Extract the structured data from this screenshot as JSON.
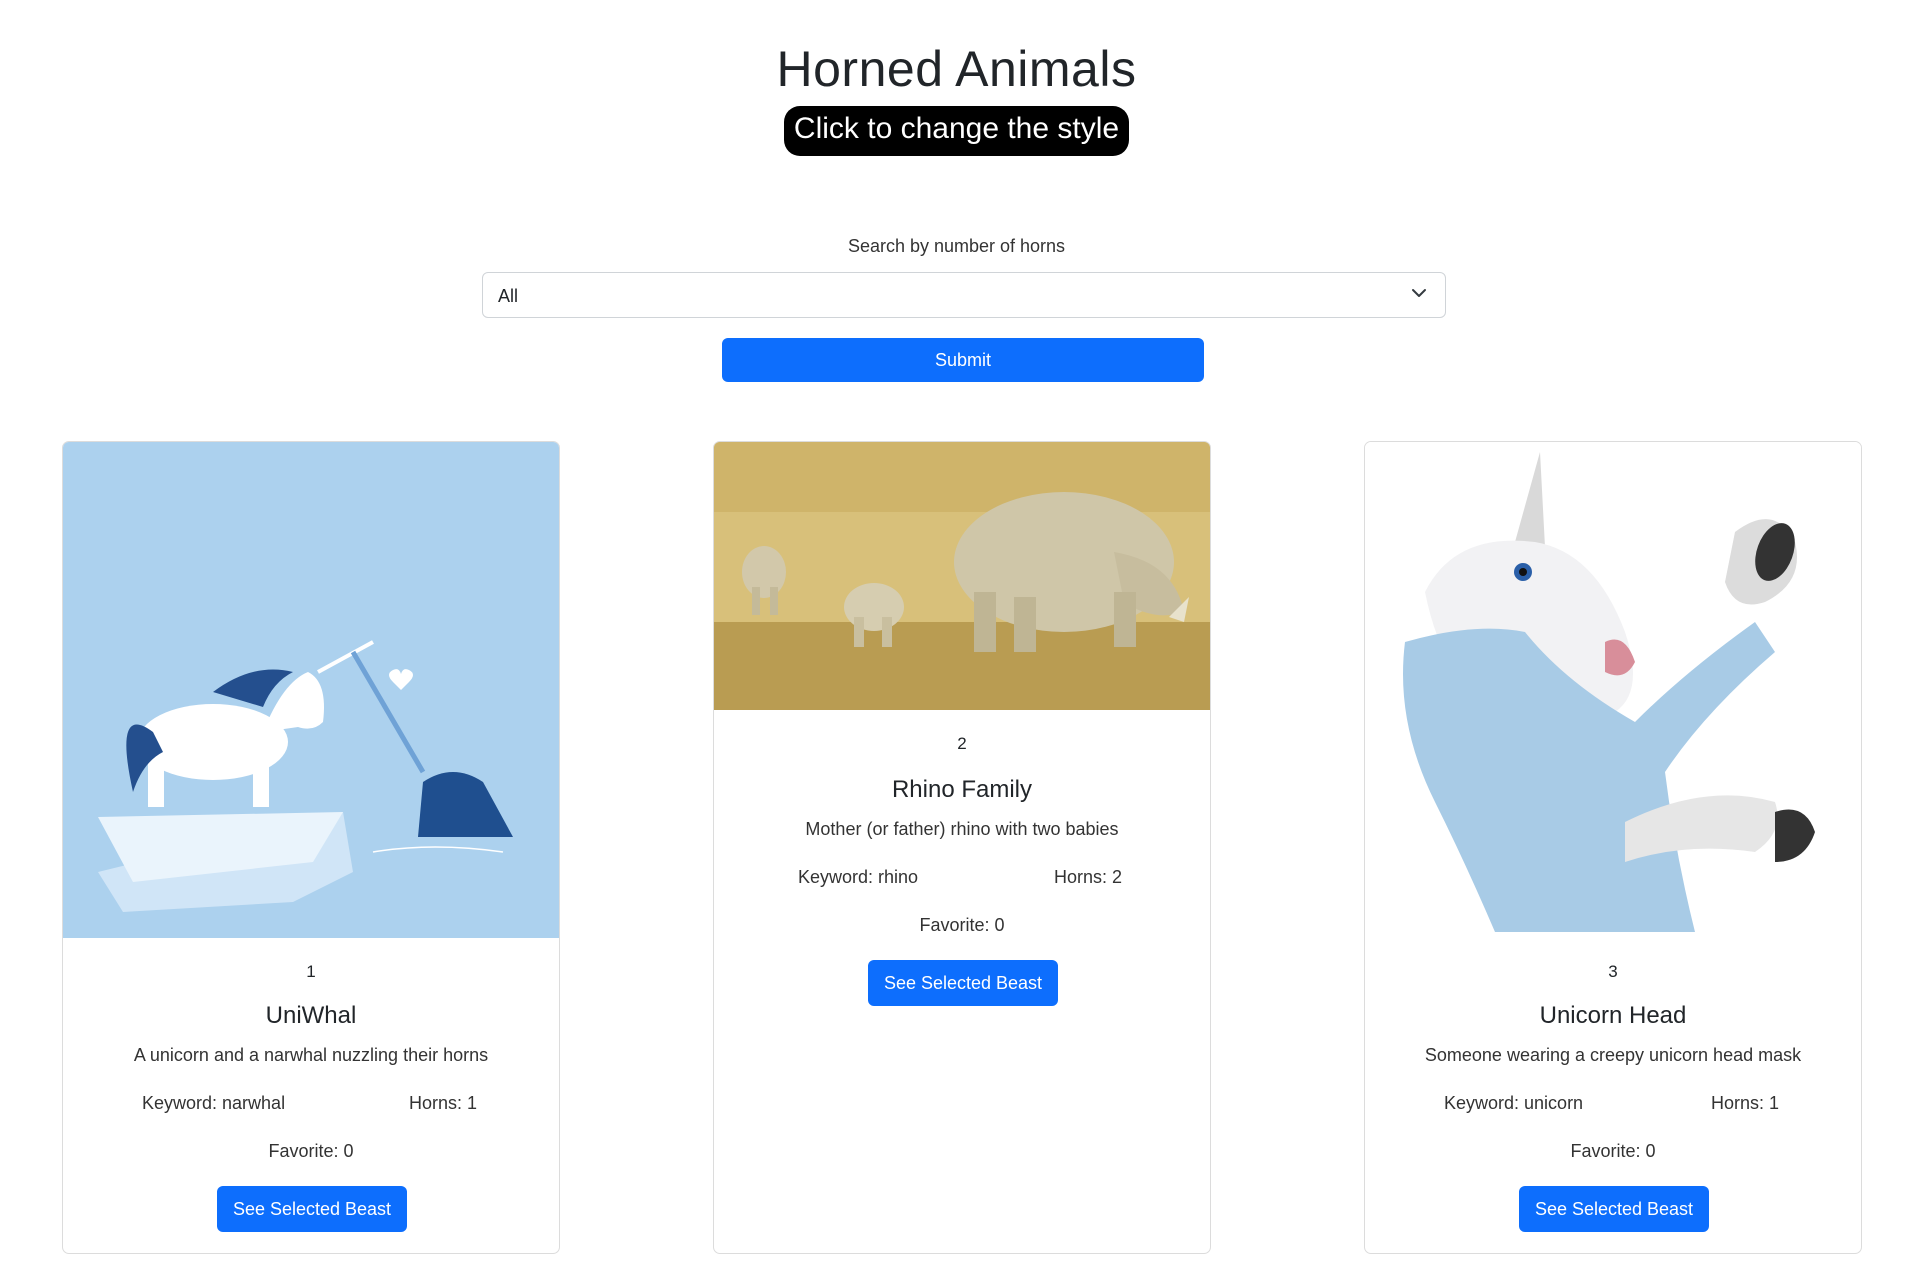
{
  "header": {
    "title": "Horned Animals",
    "style_button": "Click to change the style"
  },
  "search": {
    "label": "Search by number of horns",
    "selected": "All",
    "submit_label": "Submit"
  },
  "cards": [
    {
      "number": "1",
      "title": "UniWhal",
      "description": "A unicorn and a narwhal nuzzling their horns",
      "keyword": "Keyword: narwhal",
      "horns": "Horns: 1",
      "favorite": "Favorite: 0",
      "button": "See Selected Beast"
    },
    {
      "number": "2",
      "title": "Rhino Family",
      "description": "Mother (or father) rhino with two babies",
      "keyword": "Keyword: rhino",
      "horns": "Horns: 2",
      "favorite": "Favorite: 0",
      "button": "See Selected Beast"
    },
    {
      "number": "3",
      "title": "Unicorn Head",
      "description": "Someone wearing a creepy unicorn head mask",
      "keyword": "Keyword: unicorn",
      "horns": "Horns: 1",
      "favorite": "Favorite: 0",
      "button": "See Selected Beast"
    }
  ],
  "colors": {
    "primary": "#0d6efd",
    "style_button_bg": "#000000",
    "card_border": "#dcdcdc"
  }
}
